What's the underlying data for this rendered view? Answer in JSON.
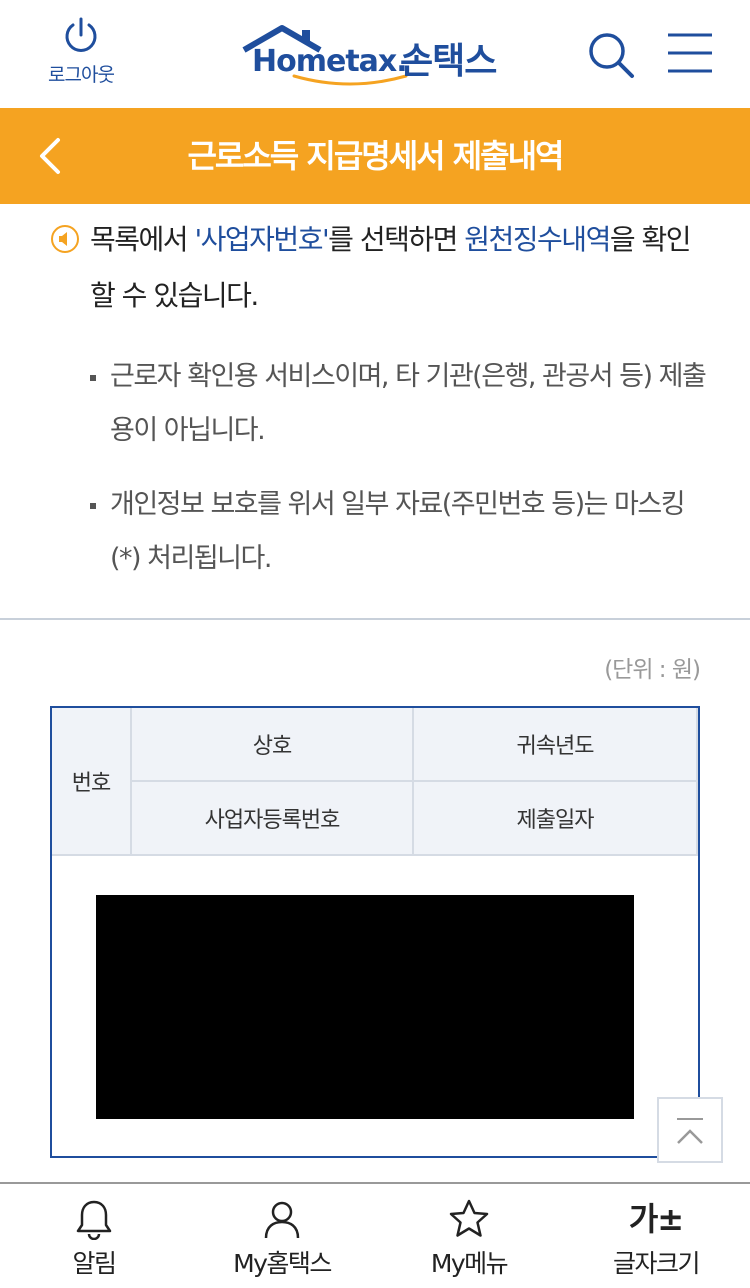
{
  "header": {
    "logout_label": "로그아웃",
    "brand_text": "Hometax.",
    "brand_korean": "손택스"
  },
  "titlebar": {
    "title": "근로소득 지급명세서 제출내역"
  },
  "notice": {
    "part1": "목록에서 ",
    "highlight1": "'사업자번호'",
    "part2": "를 선택하면 ",
    "highlight2": "원천징수내역",
    "part3": "을 확인 할 수 있습니다."
  },
  "bullets": [
    "근로자 확인용 서비스이며, 타 기관(은행, 관공서 등) 제출용이 아닙니다.",
    "개인정보 보호를 위서 일부 자료(주민번호 등)는 마스킹(*) 처리됩니다."
  ],
  "unit_label": "(단위 : 원)",
  "table": {
    "headers": {
      "number": "번호",
      "company": "상호",
      "year": "귀속년도",
      "biz_number": "사업자등록번호",
      "submit_date": "제출일자"
    }
  },
  "bottom_nav": {
    "items": [
      {
        "label": "알림",
        "icon": "bell-icon"
      },
      {
        "label": "My홈택스",
        "icon": "person-icon"
      },
      {
        "label": "My메뉴",
        "icon": "star-icon"
      },
      {
        "label": "글자크기",
        "icon": "font-size-icon",
        "glyph": "가±"
      }
    ]
  },
  "colors": {
    "brand_blue": "#1f4e9d",
    "title_orange": "#f5a321",
    "accent_orange": "#f5a321"
  }
}
